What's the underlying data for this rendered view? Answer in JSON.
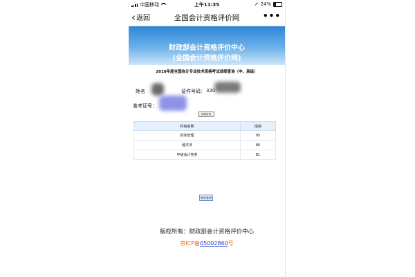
{
  "status_bar": {
    "carrier": "中国移动",
    "time": "上午11:35",
    "battery": "24%"
  },
  "nav": {
    "back_label": "返回",
    "title": "全国会计资格评价网",
    "more": "•••"
  },
  "banner": {
    "line1": "财政部会计资格评价中心",
    "line2": "(全国会计资格评价网)"
  },
  "exam_title": "2018年度全国会计专业技术资格考试成绩查询（中、高级）",
  "form": {
    "name_label": "姓名",
    "cert_label": "证件号码：",
    "cert_value": "320",
    "ticket_label": "准考证号："
  },
  "score_button": "成绩查询",
  "table": {
    "headers": [
      "科目名称",
      "成绩"
    ],
    "rows": [
      [
        "财务管理",
        "95"
      ],
      [
        "经济法",
        "86"
      ],
      [
        "中级会计实务",
        "81"
      ]
    ]
  },
  "query_button": "继续查询",
  "footer": {
    "copyright": "版权所有：财政部会计资格评价中心",
    "icp_prefix": "京ICP备",
    "icp_number": "05002860",
    "icp_suffix": "号"
  }
}
